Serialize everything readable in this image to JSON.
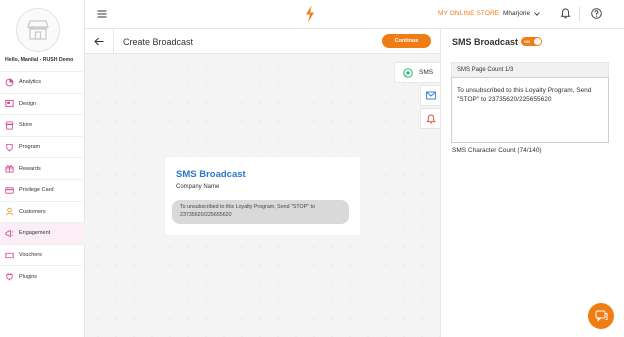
{
  "sidebar": {
    "greeting": "Hello, Manilal - RUSH Demo",
    "items": [
      {
        "label": "Analytics",
        "icon": "analytics-icon",
        "active": false
      },
      {
        "label": "Design",
        "icon": "design-icon",
        "active": false
      },
      {
        "label": "Store",
        "icon": "store-icon",
        "active": false
      },
      {
        "label": "Program",
        "icon": "program-icon",
        "active": false
      },
      {
        "label": "Rewards",
        "icon": "rewards-icon",
        "active": false
      },
      {
        "label": "Privilege Card",
        "icon": "privilege-card-icon",
        "active": false
      },
      {
        "label": "Customers",
        "icon": "customers-icon",
        "active": false
      },
      {
        "label": "Engagement",
        "icon": "engagement-icon",
        "active": true
      },
      {
        "label": "Vouchers",
        "icon": "vouchers-icon",
        "active": false
      },
      {
        "label": "Plugins",
        "icon": "plugins-icon",
        "active": false
      }
    ]
  },
  "topbar": {
    "store_name": "MY ONLINE STORE",
    "user_name": "Mharjorie"
  },
  "subheader": {
    "title": "Create Broadcast",
    "continue_label": "Continue"
  },
  "channels": {
    "sms_label": "SMS"
  },
  "preview": {
    "title": "SMS Broadcast",
    "company": "Company Name",
    "message": "To unsubscribed to this Loyalty Program, Send \"STOP\" to 23735620/225655620"
  },
  "right_panel": {
    "title": "SMS Broadcast",
    "toggle_label": "ON",
    "page_count": "SMS Page Count 1/3",
    "message_value": "To unsubscribed to this Loyalty Program, Send \"STOP\" to 23735620/225655620",
    "char_count": "SMS Character Count (74/140)"
  },
  "colors": {
    "accent": "#f07d14",
    "preview_title": "#2a78c8",
    "active_nav_bg": "#fbeef6",
    "sidebar_icon": "#d2448f"
  }
}
